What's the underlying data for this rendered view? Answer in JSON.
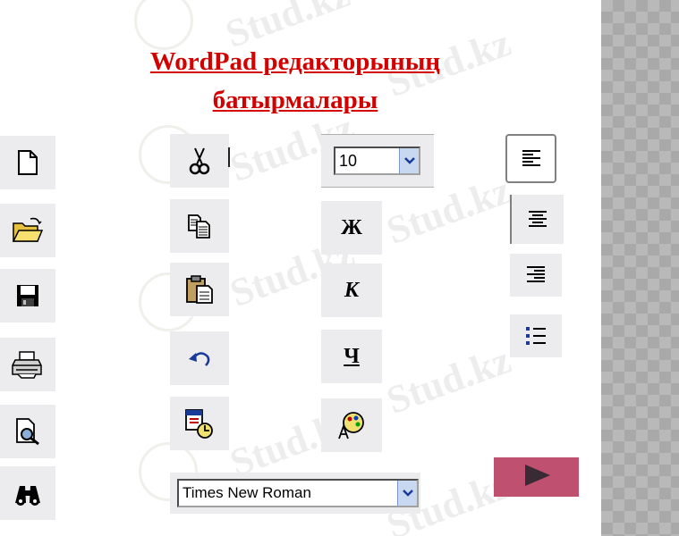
{
  "title": {
    "line1": "WordPad редакторының",
    "line2": "батырмалары"
  },
  "watermark": {
    "text": "Stud.kz"
  },
  "font_size_combo": {
    "value": "10"
  },
  "font_face_combo": {
    "value": "Times New Roman"
  },
  "format_buttons": {
    "bold": "Ж",
    "italic": "К",
    "underline": "Ч"
  },
  "colors": {
    "title": "#d40000",
    "button_bg": "#ecebee",
    "next_button": "#c05070",
    "combo_arrow": "#c8d8f0"
  },
  "icons": [
    "new-document-icon",
    "open-folder-icon",
    "save-disk-icon",
    "print-icon",
    "print-preview-icon",
    "find-binoculars-icon",
    "cut-scissors-icon",
    "copy-icon",
    "paste-icon",
    "undo-icon",
    "insert-datetime-icon",
    "color-palette-icon",
    "align-left-icon",
    "align-center-icon",
    "align-right-icon",
    "bullets-icon",
    "play-triangle-icon"
  ]
}
